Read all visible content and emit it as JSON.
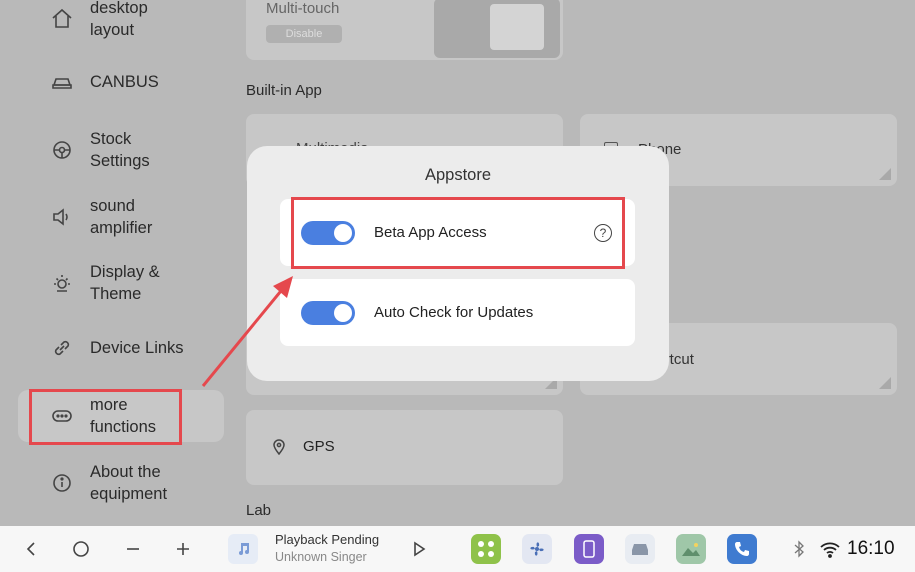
{
  "sidebar": {
    "items": [
      {
        "label": "desktop\nlayout",
        "icon": "home-icon"
      },
      {
        "label": "CANBUS",
        "icon": "car-icon"
      },
      {
        "label": "Stock\nSettings",
        "icon": "steering-wheel-icon"
      },
      {
        "label": "sound\namplifier",
        "icon": "speaker-icon"
      },
      {
        "label": "Display &\nTheme",
        "icon": "brightness-icon"
      },
      {
        "label": "Device Links",
        "icon": "link-icon"
      },
      {
        "label": "more\nfunctions",
        "icon": "more-icon"
      },
      {
        "label": "About the\nequipment",
        "icon": "info-icon"
      }
    ]
  },
  "main": {
    "multitouch": {
      "label": "Multi-touch",
      "button": "Disable"
    },
    "builtin_title": "Built-in App",
    "cards": [
      {
        "label": "Multimedia"
      },
      {
        "label": "Phone"
      },
      {
        "label": "Shortcut"
      },
      {
        "label": "GPS"
      }
    ],
    "lab_title": "Lab"
  },
  "dialog": {
    "title": "Appstore",
    "options": [
      {
        "label": "Beta App Access",
        "enabled": true,
        "help": "?"
      },
      {
        "label": "Auto Check for Updates",
        "enabled": true
      }
    ]
  },
  "taskbar": {
    "media_title": "Playback Pending",
    "media_artist": "Unknown Singer",
    "time": "16:10"
  },
  "colors": {
    "accent": "#4a7fe0",
    "highlight": "#e5484d",
    "taskbar_bg": "#f7f7f7"
  }
}
